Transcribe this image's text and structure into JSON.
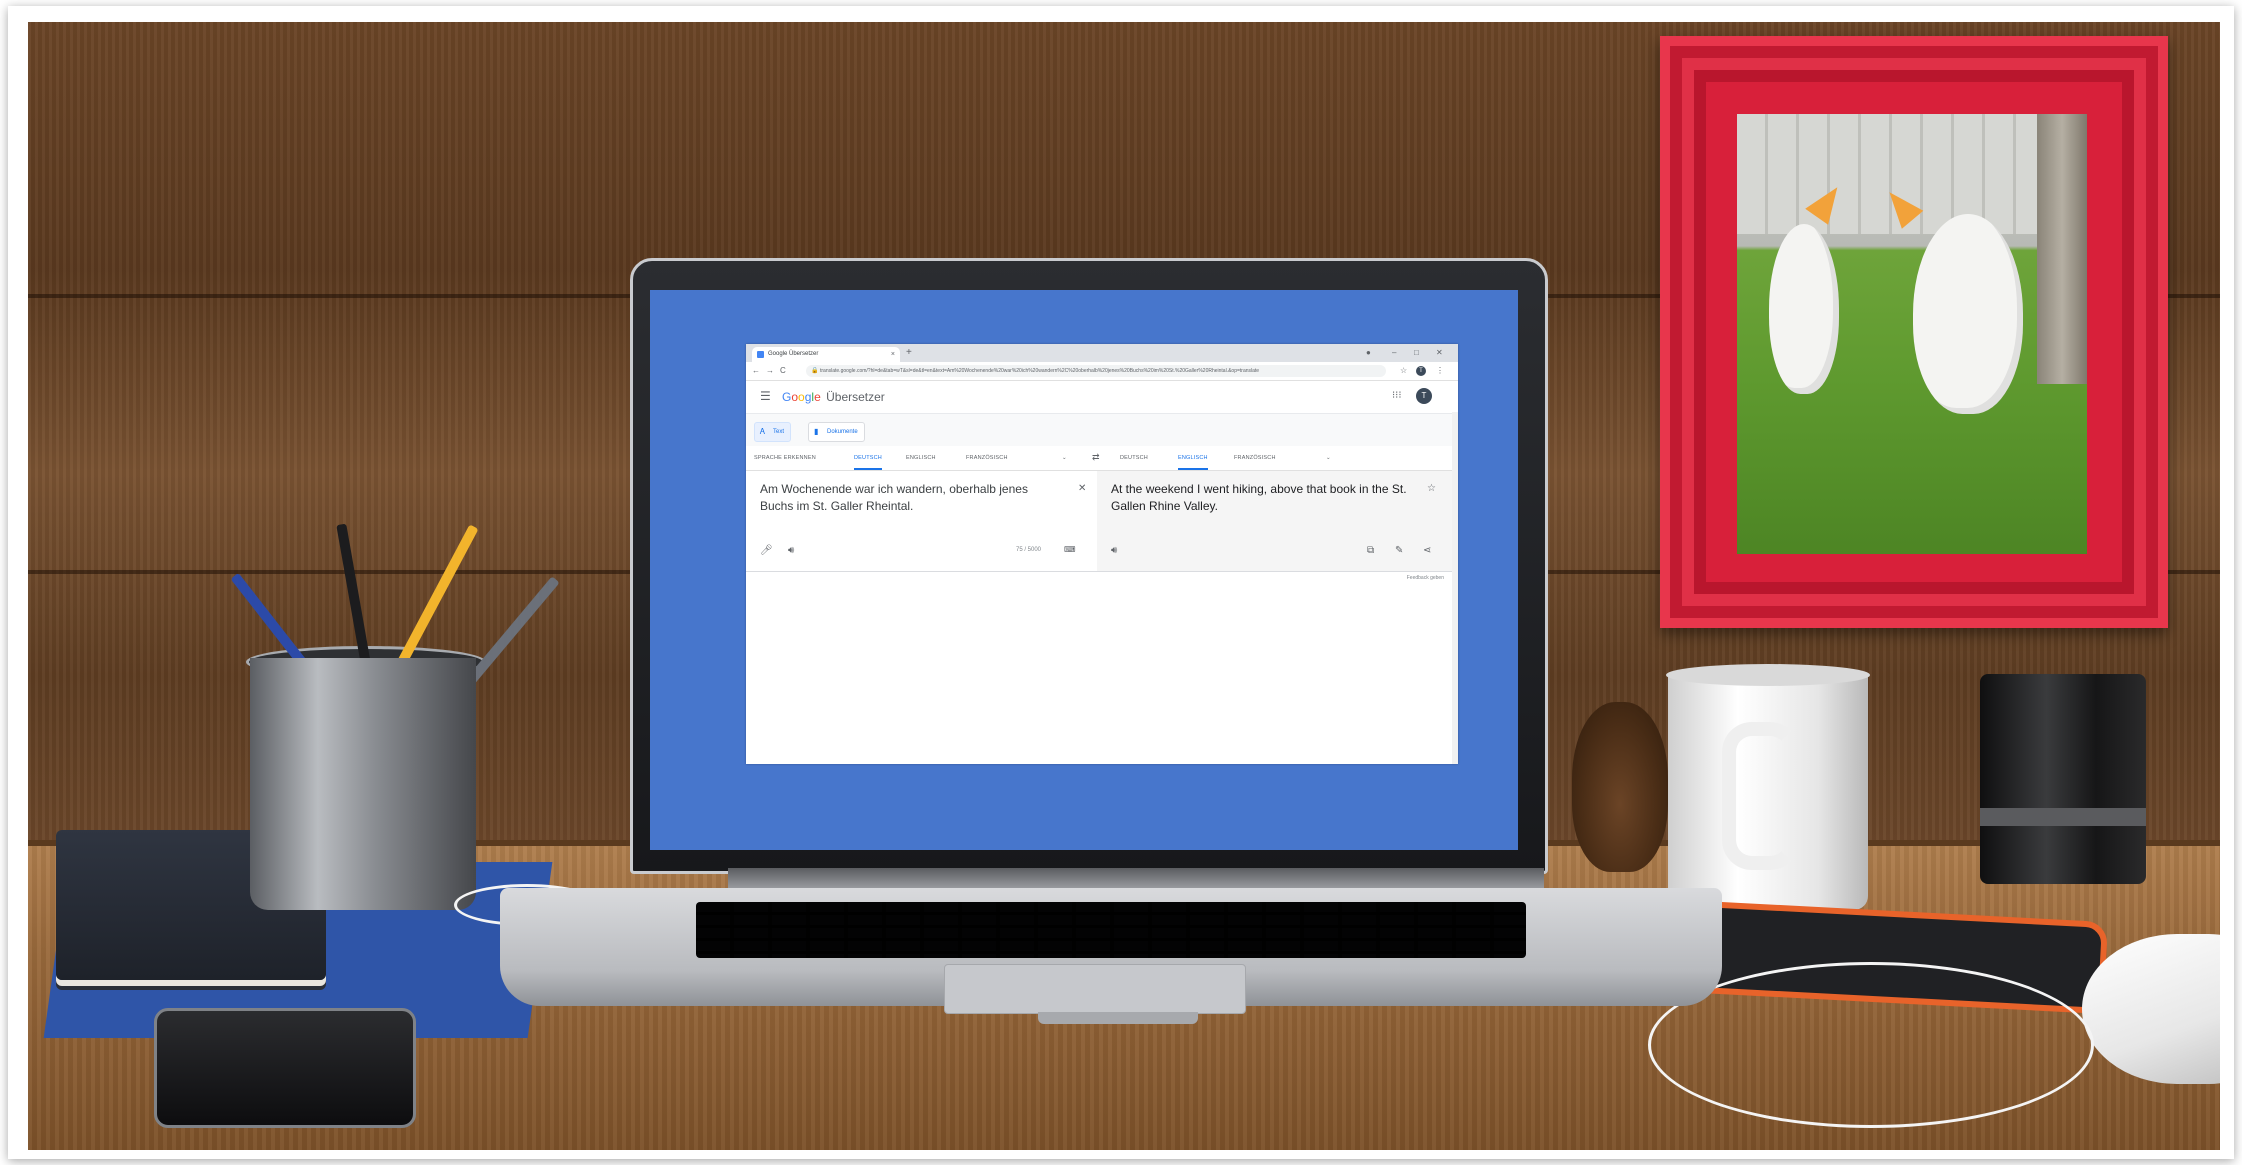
{
  "browser": {
    "tab_title": "Google Übersetzer",
    "tab_close": "×",
    "new_tab": "+",
    "window_controls": [
      "–",
      "□",
      "✕"
    ],
    "address": "translate.google.com/?hl=de&tab=wT&sl=de&tl=en&text=Am%20Wochenende%20war%20ich%20wandern%2C%20oberhalb%20jenes%20Buchs%20im%20St.%20Galler%20Rheintal.&op=translate",
    "nav": {
      "back": "←",
      "forward": "→",
      "reload": "C"
    },
    "avatar_letter": "T"
  },
  "app": {
    "brand": [
      "G",
      "o",
      "o",
      "g",
      "l",
      "e"
    ],
    "brand_colors": [
      "#4285f4",
      "#ea4335",
      "#fbbc05",
      "#4285f4",
      "#34a853",
      "#ea4335"
    ],
    "product": "Übersetzer",
    "menu_icon": "menu-icon",
    "apps_icon": "apps-grid-icon",
    "avatar_letter": "T"
  },
  "modes": [
    {
      "label": "Text",
      "icon": "translate-icon",
      "active": true
    },
    {
      "label": "Dokumente",
      "icon": "document-icon",
      "active": false
    }
  ],
  "source_langs": [
    {
      "label": "SPRACHE ERKENNEN",
      "selected": false
    },
    {
      "label": "DEUTSCH",
      "selected": true
    },
    {
      "label": "ENGLISCH",
      "selected": false
    },
    {
      "label": "FRANZÖSISCH",
      "selected": false
    }
  ],
  "target_langs": [
    {
      "label": "DEUTSCH",
      "selected": false
    },
    {
      "label": "ENGLISCH",
      "selected": true
    },
    {
      "label": "FRANZÖSISCH",
      "selected": false
    }
  ],
  "source": {
    "text": "Am Wochenende war ich wandern, oberhalb jenes Buchs im St. Galler Rheintal.",
    "count": "75 / 5000",
    "clear": "✕"
  },
  "target": {
    "text": "At the weekend I went hiking, above that book in the St. Gallen Rhine Valley.",
    "feedback": "Feedback geben"
  },
  "colors": {
    "accent": "#1a73e8",
    "screen_background": "#4776cc",
    "picture_frame": "#d8203a"
  }
}
